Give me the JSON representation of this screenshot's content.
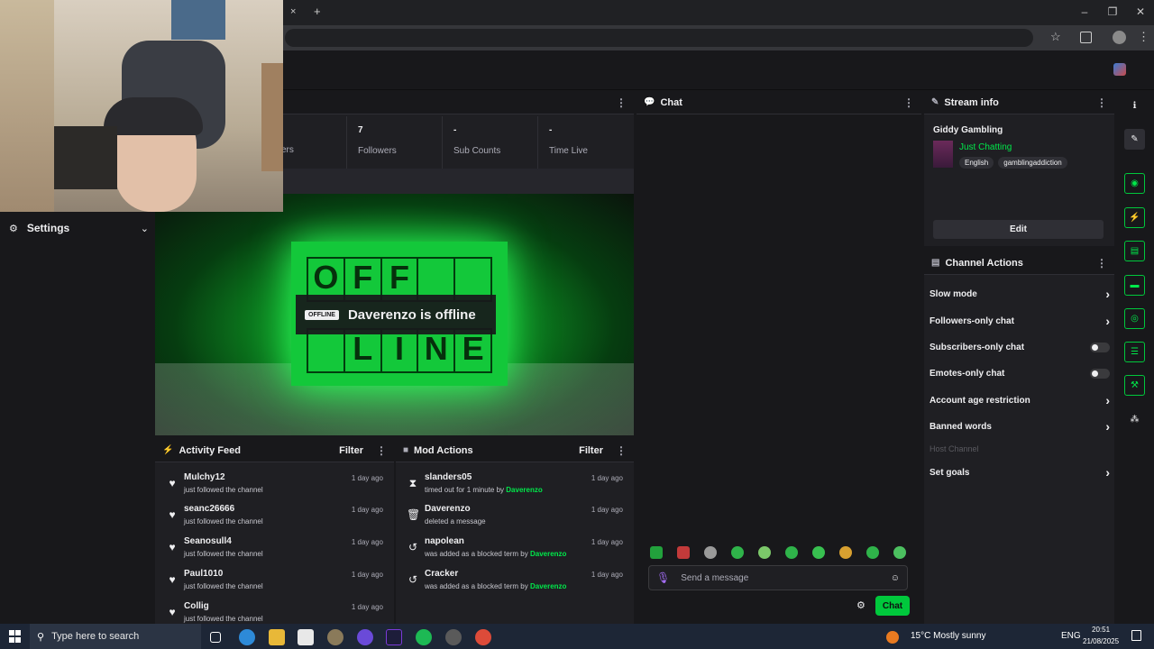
{
  "browser": {
    "tab_close": "×",
    "new_tab": "+",
    "star": "☆",
    "minimize": "–",
    "restore": "❐",
    "close": "✕"
  },
  "stats": {
    "followers_value": "7",
    "followers_label": "Followers",
    "followers_partial_label": "ers",
    "subs_value": "-",
    "subs_label": "Sub Counts",
    "time_value": "-",
    "time_label": "Time Live"
  },
  "settings": {
    "label": "Settings"
  },
  "player": {
    "badge": "OFFLINE",
    "message": "Daverenzo is offline",
    "sign_top": [
      "O",
      "F",
      "F",
      "",
      ""
    ],
    "sign_bottom": [
      "",
      "L",
      "I",
      "N",
      "E"
    ]
  },
  "chat": {
    "title": "Chat",
    "placeholder": "Send a message",
    "button": "Chat"
  },
  "stream_info": {
    "title": "Stream info",
    "stream_title": "Giddy Gambling",
    "category": "Just Chatting",
    "tags": [
      "English",
      "gamblingaddiction"
    ],
    "edit_label": "Edit"
  },
  "channel_actions": {
    "title": "Channel Actions",
    "items": [
      {
        "label": "Slow mode"
      },
      {
        "label": "Followers-only chat"
      },
      {
        "label": "Subscribers-only chat"
      },
      {
        "label": "Emotes-only chat"
      },
      {
        "label": "Account age restriction"
      },
      {
        "label": "Banned words"
      },
      {
        "label": "Host Channel"
      },
      {
        "label": "Set goals"
      }
    ]
  },
  "activity_feed": {
    "title": "Activity Feed",
    "filter": "Filter",
    "items": [
      {
        "name": "Mulchy12",
        "sub": "just followed the channel",
        "time": "1 day ago"
      },
      {
        "name": "seanc26666",
        "sub": "just followed the channel",
        "time": "1 day ago"
      },
      {
        "name": "Seanosull4",
        "sub": "just followed the channel",
        "time": "1 day ago"
      },
      {
        "name": "Paul1010",
        "sub": "just followed the channel",
        "time": "1 day ago"
      },
      {
        "name": "Collig",
        "sub": "just followed the channel",
        "time": "1 day ago"
      }
    ]
  },
  "mod_actions": {
    "title": "Mod Actions",
    "filter": "Filter",
    "items": [
      {
        "name": "slanders05",
        "sub": "timed out for 1 minute by",
        "by": "Daverenzo",
        "time": "1 day ago"
      },
      {
        "name": "Daverenzo",
        "sub": "deleted a message",
        "by": "",
        "time": "1 day ago"
      },
      {
        "name": "napolean",
        "sub": "was added as a blocked term by",
        "by": "Daverenzo",
        "time": "1 day ago"
      },
      {
        "name": "Cracker",
        "sub": "was added as a blocked term by",
        "by": "Daverenzo",
        "time": "1 day ago"
      }
    ]
  },
  "taskbar": {
    "search_placeholder": "Type here to search",
    "weather": "15°C  Mostly sunny",
    "lang": "ENG",
    "time": "20:51",
    "date": "21/08/2025"
  },
  "colors": {
    "accent": "#00e84a",
    "panel": "#1f1f23",
    "bg": "#18181b"
  }
}
